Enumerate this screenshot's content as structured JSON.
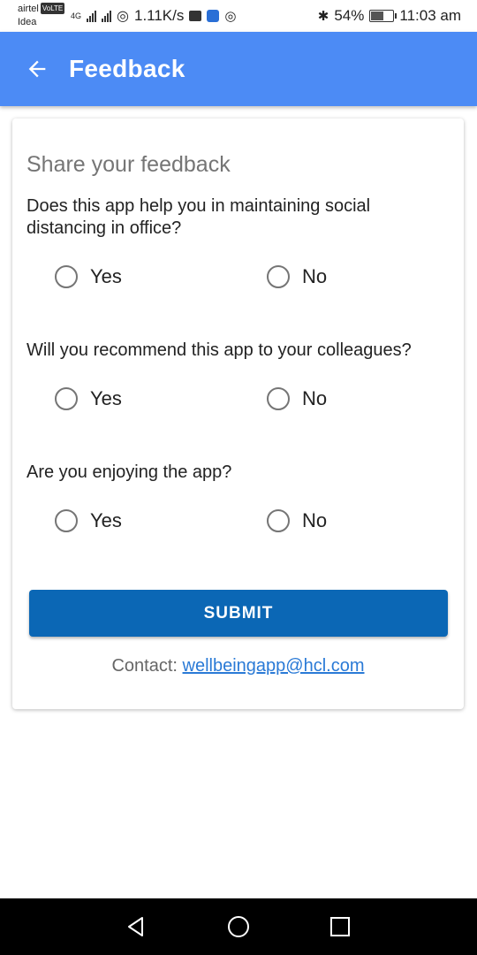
{
  "status_bar": {
    "carrier1": "airtel",
    "badge1": "VoLTE",
    "net1": "4G",
    "carrier2": "Idea",
    "speed": "1.11K/s",
    "battery_pct": "54%",
    "battery_level": 0.54,
    "time": "11:03 am"
  },
  "app_bar": {
    "title": "Feedback",
    "color": "#4c8bf5"
  },
  "card": {
    "title": "Share your feedback",
    "questions": [
      {
        "text": "Does this app help you in maintaining social distancing in office?",
        "yes": "Yes",
        "no": "No"
      },
      {
        "text": "Will you recommend this app to your colleagues?",
        "yes": "Yes",
        "no": "No"
      },
      {
        "text": "Are you enjoying the app?",
        "yes": "Yes",
        "no": "No"
      }
    ],
    "submit_label": "SUBMIT",
    "submit_color": "#0b67b5",
    "contact_prefix": "Contact: ",
    "contact_email": "wellbeingapp@hcl.com"
  },
  "nav_bar": {
    "buttons": [
      "back-nav-icon",
      "home-nav-icon",
      "recents-nav-icon"
    ]
  }
}
